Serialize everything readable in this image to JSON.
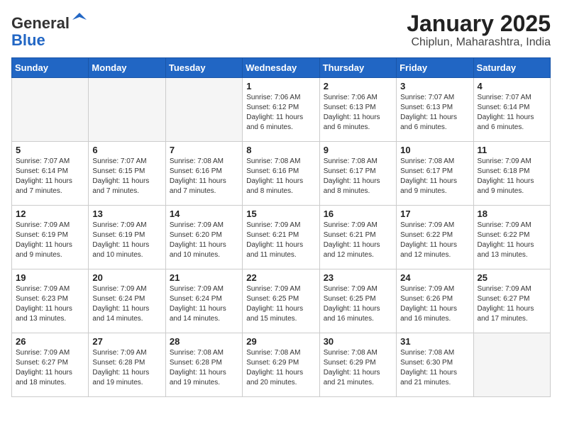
{
  "logo": {
    "general": "General",
    "blue": "Blue"
  },
  "title": "January 2025",
  "location": "Chiplun, Maharashtra, India",
  "days_of_week": [
    "Sunday",
    "Monday",
    "Tuesday",
    "Wednesday",
    "Thursday",
    "Friday",
    "Saturday"
  ],
  "weeks": [
    [
      {
        "day": "",
        "info": ""
      },
      {
        "day": "",
        "info": ""
      },
      {
        "day": "",
        "info": ""
      },
      {
        "day": "1",
        "info": "Sunrise: 7:06 AM\nSunset: 6:12 PM\nDaylight: 11 hours and 6 minutes."
      },
      {
        "day": "2",
        "info": "Sunrise: 7:06 AM\nSunset: 6:13 PM\nDaylight: 11 hours and 6 minutes."
      },
      {
        "day": "3",
        "info": "Sunrise: 7:07 AM\nSunset: 6:13 PM\nDaylight: 11 hours and 6 minutes."
      },
      {
        "day": "4",
        "info": "Sunrise: 7:07 AM\nSunset: 6:14 PM\nDaylight: 11 hours and 6 minutes."
      }
    ],
    [
      {
        "day": "5",
        "info": "Sunrise: 7:07 AM\nSunset: 6:14 PM\nDaylight: 11 hours and 7 minutes."
      },
      {
        "day": "6",
        "info": "Sunrise: 7:07 AM\nSunset: 6:15 PM\nDaylight: 11 hours and 7 minutes."
      },
      {
        "day": "7",
        "info": "Sunrise: 7:08 AM\nSunset: 6:16 PM\nDaylight: 11 hours and 7 minutes."
      },
      {
        "day": "8",
        "info": "Sunrise: 7:08 AM\nSunset: 6:16 PM\nDaylight: 11 hours and 8 minutes."
      },
      {
        "day": "9",
        "info": "Sunrise: 7:08 AM\nSunset: 6:17 PM\nDaylight: 11 hours and 8 minutes."
      },
      {
        "day": "10",
        "info": "Sunrise: 7:08 AM\nSunset: 6:17 PM\nDaylight: 11 hours and 9 minutes."
      },
      {
        "day": "11",
        "info": "Sunrise: 7:09 AM\nSunset: 6:18 PM\nDaylight: 11 hours and 9 minutes."
      }
    ],
    [
      {
        "day": "12",
        "info": "Sunrise: 7:09 AM\nSunset: 6:19 PM\nDaylight: 11 hours and 9 minutes."
      },
      {
        "day": "13",
        "info": "Sunrise: 7:09 AM\nSunset: 6:19 PM\nDaylight: 11 hours and 10 minutes."
      },
      {
        "day": "14",
        "info": "Sunrise: 7:09 AM\nSunset: 6:20 PM\nDaylight: 11 hours and 10 minutes."
      },
      {
        "day": "15",
        "info": "Sunrise: 7:09 AM\nSunset: 6:21 PM\nDaylight: 11 hours and 11 minutes."
      },
      {
        "day": "16",
        "info": "Sunrise: 7:09 AM\nSunset: 6:21 PM\nDaylight: 11 hours and 12 minutes."
      },
      {
        "day": "17",
        "info": "Sunrise: 7:09 AM\nSunset: 6:22 PM\nDaylight: 11 hours and 12 minutes."
      },
      {
        "day": "18",
        "info": "Sunrise: 7:09 AM\nSunset: 6:22 PM\nDaylight: 11 hours and 13 minutes."
      }
    ],
    [
      {
        "day": "19",
        "info": "Sunrise: 7:09 AM\nSunset: 6:23 PM\nDaylight: 11 hours and 13 minutes."
      },
      {
        "day": "20",
        "info": "Sunrise: 7:09 AM\nSunset: 6:24 PM\nDaylight: 11 hours and 14 minutes."
      },
      {
        "day": "21",
        "info": "Sunrise: 7:09 AM\nSunset: 6:24 PM\nDaylight: 11 hours and 14 minutes."
      },
      {
        "day": "22",
        "info": "Sunrise: 7:09 AM\nSunset: 6:25 PM\nDaylight: 11 hours and 15 minutes."
      },
      {
        "day": "23",
        "info": "Sunrise: 7:09 AM\nSunset: 6:25 PM\nDaylight: 11 hours and 16 minutes."
      },
      {
        "day": "24",
        "info": "Sunrise: 7:09 AM\nSunset: 6:26 PM\nDaylight: 11 hours and 16 minutes."
      },
      {
        "day": "25",
        "info": "Sunrise: 7:09 AM\nSunset: 6:27 PM\nDaylight: 11 hours and 17 minutes."
      }
    ],
    [
      {
        "day": "26",
        "info": "Sunrise: 7:09 AM\nSunset: 6:27 PM\nDaylight: 11 hours and 18 minutes."
      },
      {
        "day": "27",
        "info": "Sunrise: 7:09 AM\nSunset: 6:28 PM\nDaylight: 11 hours and 19 minutes."
      },
      {
        "day": "28",
        "info": "Sunrise: 7:08 AM\nSunset: 6:28 PM\nDaylight: 11 hours and 19 minutes."
      },
      {
        "day": "29",
        "info": "Sunrise: 7:08 AM\nSunset: 6:29 PM\nDaylight: 11 hours and 20 minutes."
      },
      {
        "day": "30",
        "info": "Sunrise: 7:08 AM\nSunset: 6:29 PM\nDaylight: 11 hours and 21 minutes."
      },
      {
        "day": "31",
        "info": "Sunrise: 7:08 AM\nSunset: 6:30 PM\nDaylight: 11 hours and 21 minutes."
      },
      {
        "day": "",
        "info": ""
      }
    ]
  ]
}
